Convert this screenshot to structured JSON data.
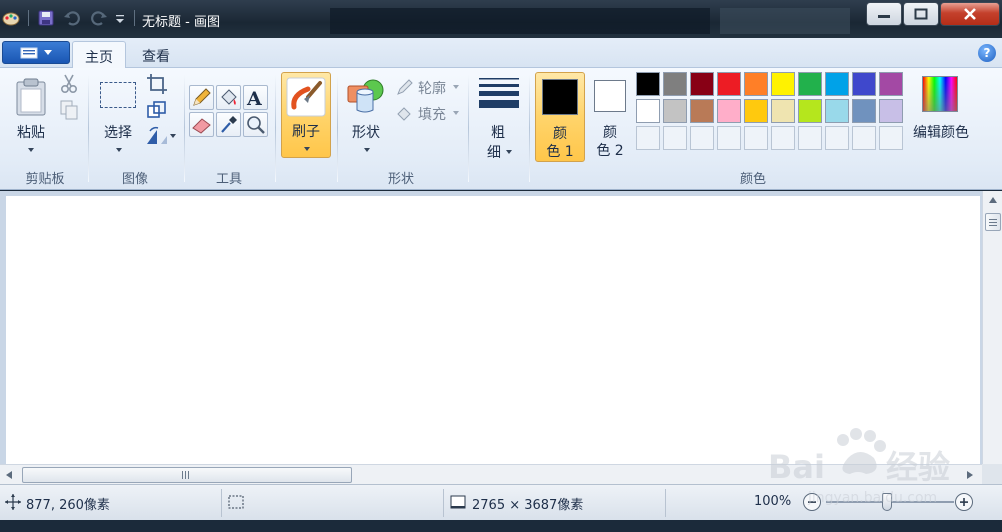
{
  "window": {
    "title": "无标题 - 画图"
  },
  "tabs": {
    "home": "主页",
    "view": "查看"
  },
  "ribbon": {
    "clipboard": {
      "paste": "粘贴",
      "group": "剪贴板"
    },
    "image": {
      "select": "选择",
      "group": "图像"
    },
    "tools": {
      "group": "工具"
    },
    "brushes": {
      "label": "刷子"
    },
    "shapes": {
      "label": "形状",
      "outline": "轮廓",
      "fill": "填充",
      "group": "形状"
    },
    "size": {
      "line1": "粗",
      "line2": "细"
    },
    "colors": {
      "color1_line1": "颜",
      "color1_line2": "色 1",
      "color2_line1": "颜",
      "color2_line2": "色 2",
      "edit": "编辑颜色",
      "group": "颜色",
      "color1": "#000000",
      "color2": "#ffffff",
      "palette_row1": [
        "#000000",
        "#7f7f7f",
        "#880015",
        "#ed1c24",
        "#ff7f27",
        "#fff200",
        "#22b14c",
        "#00a2e8",
        "#3f48cc",
        "#a349a4"
      ],
      "palette_row2": [
        "#ffffff",
        "#c3c3c3",
        "#b97a57",
        "#ffaec9",
        "#ffc90e",
        "#efe4b0",
        "#b5e61d",
        "#99d9ea",
        "#7092be",
        "#c8bfe7"
      ]
    }
  },
  "statusbar": {
    "cursor_pos": "877, 260像素",
    "image_size": "2765 × 3687像素",
    "zoom": "100%"
  }
}
